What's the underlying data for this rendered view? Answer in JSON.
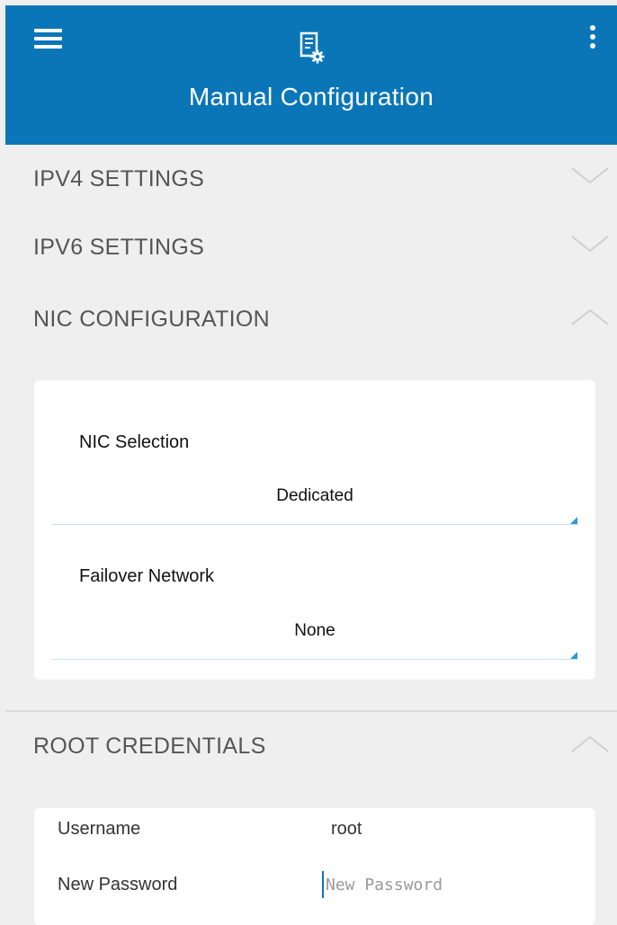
{
  "header": {
    "title": "Manual Configuration",
    "background": "#0a76b8",
    "menu_icon": "hamburger-menu-icon",
    "center_icon": "document-settings-icon",
    "overflow_icon": "vertical-dots-icon"
  },
  "sections": {
    "ipv4": {
      "label": "IPV4 SETTINGS",
      "state": "collapsed"
    },
    "ipv6": {
      "label": "IPV6 SETTINGS",
      "state": "collapsed"
    },
    "nic": {
      "label": "NIC CONFIGURATION",
      "state": "expanded"
    },
    "root": {
      "label": "ROOT CREDENTIALS",
      "state": "expanded"
    }
  },
  "nic": {
    "selection_label": "NIC Selection",
    "selection_value": "Dedicated",
    "failover_label": "Failover Network",
    "failover_value": "None"
  },
  "credentials": {
    "username_label": "Username",
    "username_value": "root",
    "password_label": "New Password",
    "password_placeholder": "New Password",
    "password_value": ""
  }
}
